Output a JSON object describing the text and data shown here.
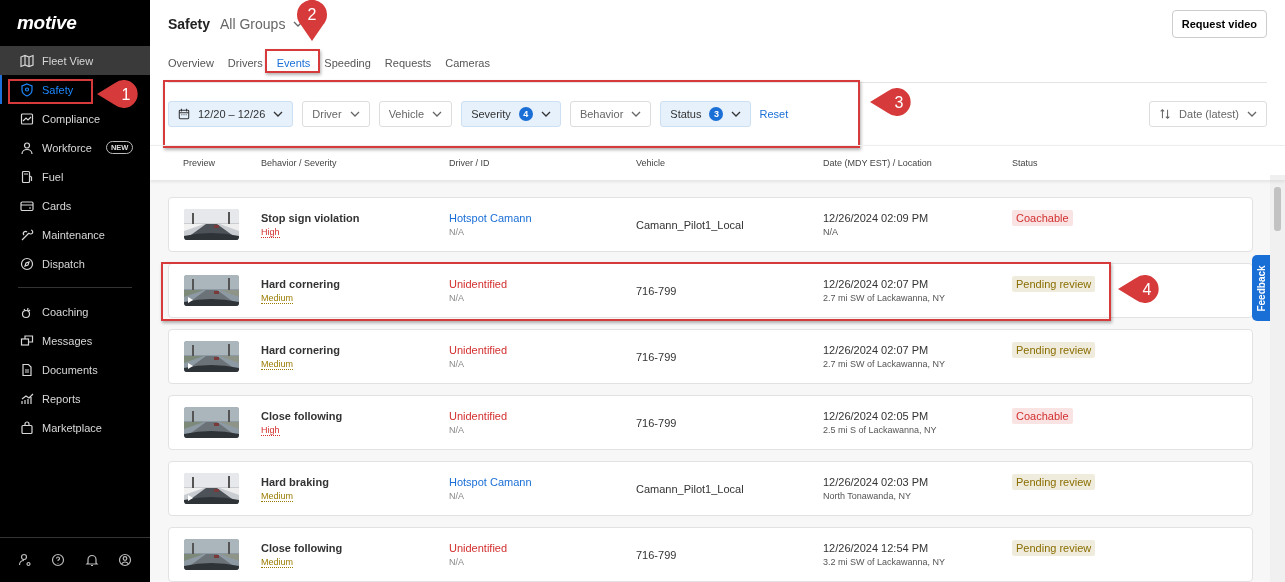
{
  "sidebar": {
    "logo": "motive",
    "sections": [
      {
        "items": [
          {
            "label": "Fleet View",
            "selected": false,
            "highlighted": true
          },
          {
            "label": "Safety",
            "selected": true,
            "highlighted": false,
            "callout": "1"
          },
          {
            "label": "Compliance",
            "selected": false,
            "highlighted": false
          },
          {
            "label": "Workforce",
            "selected": false,
            "highlighted": false,
            "badge": "NEW"
          },
          {
            "label": "Fuel",
            "selected": false,
            "highlighted": false
          },
          {
            "label": "Cards",
            "selected": false,
            "highlighted": false
          },
          {
            "label": "Maintenance",
            "selected": false,
            "highlighted": false
          },
          {
            "label": "Dispatch",
            "selected": false,
            "highlighted": false
          }
        ]
      },
      {
        "items": [
          {
            "label": "Coaching",
            "selected": false,
            "highlighted": false
          },
          {
            "label": "Messages",
            "selected": false,
            "highlighted": false
          },
          {
            "label": "Documents",
            "selected": false,
            "highlighted": false
          },
          {
            "label": "Reports",
            "selected": false,
            "highlighted": false
          },
          {
            "label": "Marketplace",
            "selected": false,
            "highlighted": false
          }
        ]
      }
    ]
  },
  "header": {
    "title": "Safety",
    "group": "All Groups",
    "request_button": "Request video"
  },
  "tabs": [
    {
      "label": "Overview",
      "selected": false
    },
    {
      "label": "Drivers",
      "selected": false
    },
    {
      "label": "Events",
      "selected": true,
      "callout": "2"
    },
    {
      "label": "Speeding",
      "selected": false
    },
    {
      "label": "Requests",
      "selected": false
    },
    {
      "label": "Cameras",
      "selected": false
    }
  ],
  "filters": {
    "callout": "3",
    "items": [
      {
        "label": "12/20 – 12/26",
        "kind": "date",
        "active": true
      },
      {
        "label": "Driver",
        "kind": "select",
        "active": false
      },
      {
        "label": "Vehicle",
        "kind": "select",
        "active": false
      },
      {
        "label": "Severity",
        "kind": "select",
        "active": true,
        "count": "4"
      },
      {
        "label": "Behavior",
        "kind": "select",
        "active": false
      },
      {
        "label": "Status",
        "kind": "select",
        "active": true,
        "count": "3"
      }
    ],
    "reset": "Reset",
    "sort": "Date (latest)"
  },
  "table": {
    "columns": [
      "Preview",
      "Behavior / Severity",
      "Driver / ID",
      "Vehicle",
      "Date (MDY EST) / Location",
      "Status"
    ],
    "rows": [
      {
        "behavior": "Stop sign violation",
        "severity": {
          "label": "High",
          "color": "#d32f2f"
        },
        "driver": "Hotspot Camann",
        "identified": true,
        "driver_id": "N/A",
        "vehicle": "Camann_Pilot1_Local",
        "date": "12/26/2024 02:09 PM",
        "location": "N/A",
        "status": {
          "label": "Coachable",
          "color": "#d32f2f"
        },
        "play": false
      },
      {
        "behavior": "Hard cornering",
        "severity": {
          "label": "Medium",
          "color": "#9a7b00"
        },
        "driver": "Unidentified",
        "identified": false,
        "driver_id": "N/A",
        "vehicle": "716-799",
        "date": "12/26/2024 02:07 PM",
        "location": "2.7 mi SW of Lackawanna, NY",
        "status": {
          "label": "Pending review",
          "color": "#8a6d00"
        },
        "play": true,
        "callout": "4"
      },
      {
        "behavior": "Hard cornering",
        "severity": {
          "label": "Medium",
          "color": "#9a7b00"
        },
        "driver": "Unidentified",
        "identified": false,
        "driver_id": "N/A",
        "vehicle": "716-799",
        "date": "12/26/2024 02:07 PM",
        "location": "2.7 mi SW of Lackawanna, NY",
        "status": {
          "label": "Pending review",
          "color": "#8a6d00"
        },
        "play": true
      },
      {
        "behavior": "Close following",
        "severity": {
          "label": "High",
          "color": "#d32f2f"
        },
        "driver": "Unidentified",
        "identified": false,
        "driver_id": "N/A",
        "vehicle": "716-799",
        "date": "12/26/2024 02:05 PM",
        "location": "2.5 mi S of Lackawanna, NY",
        "status": {
          "label": "Coachable",
          "color": "#d32f2f"
        },
        "play": false
      },
      {
        "behavior": "Hard braking",
        "severity": {
          "label": "Medium",
          "color": "#9a7b00"
        },
        "driver": "Hotspot Camann",
        "identified": true,
        "driver_id": "N/A",
        "vehicle": "Camann_Pilot1_Local",
        "date": "12/26/2024 02:03 PM",
        "location": "North Tonawanda, NY",
        "status": {
          "label": "Pending review",
          "color": "#8a6d00"
        },
        "play": true
      },
      {
        "behavior": "Close following",
        "severity": {
          "label": "Medium",
          "color": "#9a7b00"
        },
        "driver": "Unidentified",
        "identified": false,
        "driver_id": "N/A",
        "vehicle": "716-799",
        "date": "12/26/2024 12:54 PM",
        "location": "3.2 mi SW of Lackawanna, NY",
        "status": {
          "label": "Pending review",
          "color": "#8a6d00"
        },
        "play": false
      }
    ]
  },
  "feedback": "Feedback"
}
